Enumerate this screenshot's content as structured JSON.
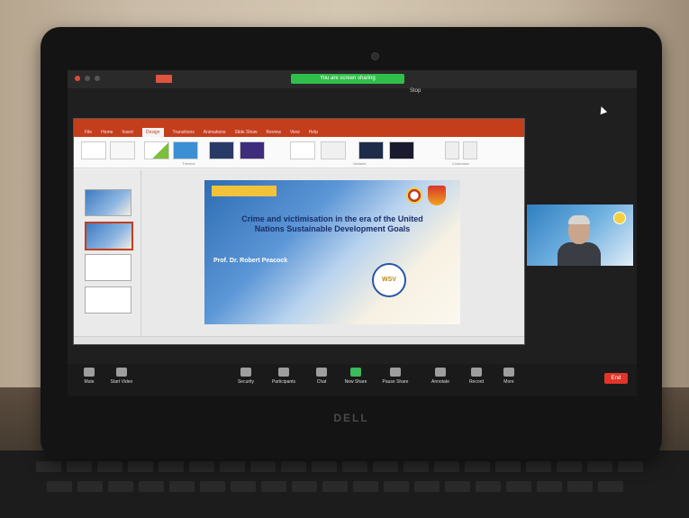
{
  "zoom": {
    "share_banner": "You are screen sharing",
    "meeting_title": "",
    "top_url": "",
    "top_button": "Stop",
    "top_right": "",
    "toolbar": [
      {
        "label": "Mute",
        "icon": "microphone-icon"
      },
      {
        "label": "Start Video",
        "icon": "video-camera-icon"
      },
      {
        "label": "Security",
        "icon": "shield-icon"
      },
      {
        "label": "Participants",
        "icon": "participants-icon"
      },
      {
        "label": "Chat",
        "icon": "chat-icon"
      },
      {
        "label": "New Share",
        "icon": "share-screen-icon"
      },
      {
        "label": "Pause Share",
        "icon": "pause-icon"
      },
      {
        "label": "Annotate",
        "icon": "annotate-icon"
      },
      {
        "label": "Record",
        "icon": "record-icon"
      },
      {
        "label": "More",
        "icon": "more-icon"
      }
    ],
    "end_label": "End",
    "participant_name": ""
  },
  "powerpoint": {
    "title": "",
    "tabs": [
      "File",
      "Home",
      "Insert",
      "Design",
      "Transitions",
      "Animations",
      "Slide Show",
      "Review",
      "View",
      "Help"
    ],
    "active_tab": "Design",
    "ribbon_groups": [
      "Themes",
      "Variants",
      "Customize"
    ]
  },
  "slide": {
    "header_chip": "",
    "subheader": "",
    "title": "Crime and victimisation in the era of the United Nations Sustainable Development Goals",
    "presenter": "Prof. Dr. Robert Peacock",
    "affiliation": [
      "",
      "",
      ""
    ],
    "badge": "WSV"
  },
  "laptop_brand": "DELL",
  "colors": {
    "ppt_accent": "#c43e1c",
    "zoom_green": "#2fbf4a",
    "end_red": "#e0352b"
  }
}
